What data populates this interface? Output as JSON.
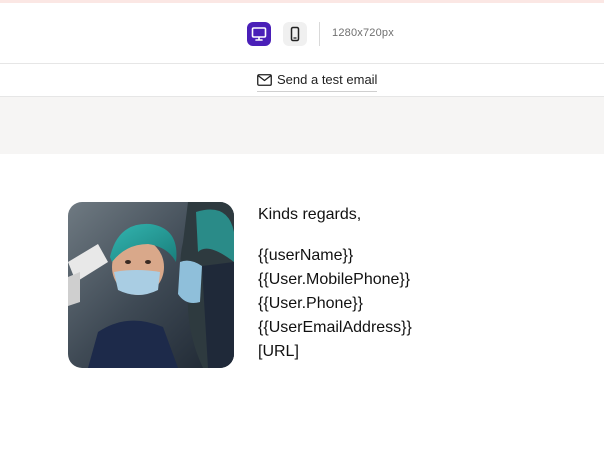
{
  "toolbar": {
    "viewport_size": "1280x720px",
    "desktop_icon": "desktop-icon",
    "mobile_icon": "mobile-icon",
    "accent_color": "#4a1fb8"
  },
  "test_email": {
    "label": "Send a test email",
    "icon": "envelope-icon"
  },
  "signature": {
    "greeting": "Kinds regards,",
    "lines": [
      "{{userName}}",
      "{{User.MobilePhone}}",
      "{{User.Phone}}",
      "{{UserEmailAddress}}",
      "[URL]"
    ]
  }
}
